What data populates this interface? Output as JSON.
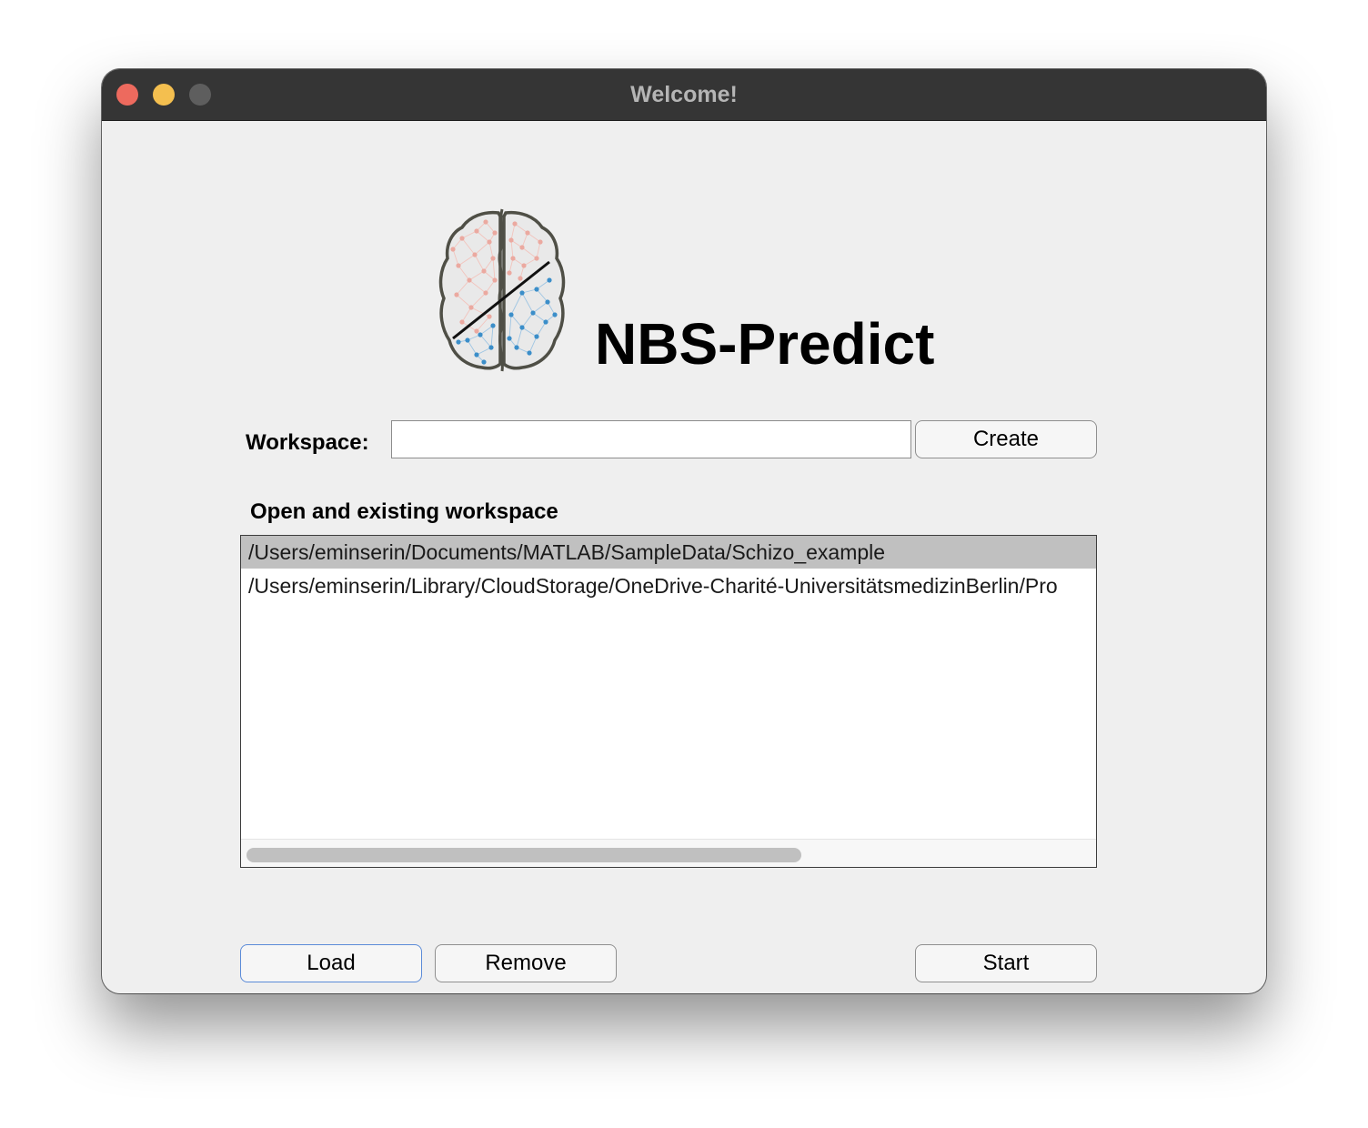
{
  "window": {
    "title": "Welcome!"
  },
  "app": {
    "name": "NBS-Predict",
    "logo_icon": "brain-network-icon"
  },
  "workspace": {
    "label": "Workspace:",
    "value": "",
    "placeholder": "",
    "create_label": "Create"
  },
  "existing": {
    "heading": "Open and existing workspace",
    "items": [
      {
        "path": "/Users/eminserin/Documents/MATLAB/SampleData/Schizo_example",
        "selected": true
      },
      {
        "path": "/Users/eminserin/Library/CloudStorage/OneDrive-Charité-UniversitätsmedizinBerlin/Pro",
        "selected": false
      }
    ]
  },
  "actions": {
    "load_label": "Load",
    "remove_label": "Remove",
    "start_label": "Start"
  },
  "colors": {
    "left_hemisphere_nodes": "#eba9a0",
    "right_hemisphere_nodes": "#3b8ec9",
    "close_button": "#ed6a5e",
    "minimize_button": "#f4bf4f",
    "focus_border": "#5b8bd8"
  }
}
